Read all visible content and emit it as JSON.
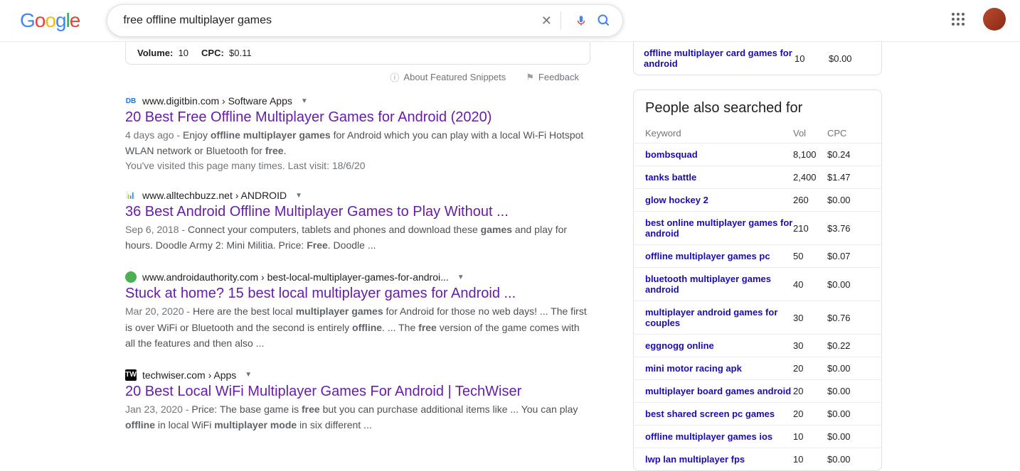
{
  "search": {
    "query": "free offline multiplayer games"
  },
  "metrics": {
    "volume_label": "Volume:",
    "volume_value": "10",
    "cpc_label": "CPC:",
    "cpc_value": "$0.11"
  },
  "snippet_links": {
    "about": "About Featured Snippets",
    "feedback": "Feedback"
  },
  "results": [
    {
      "favicon_text": "DB",
      "favicon_bg": "#fff",
      "favicon_color": "#1a73e8",
      "breadcrumb": "www.digitbin.com › Software Apps",
      "title": "20 Best Free Offline Multiplayer Games for Android (2020)",
      "date": "4 days ago",
      "snippet_html": "Enjoy <b>offline multiplayer games</b> for Android which you can play with a local Wi-Fi Hotspot WLAN network or Bluetooth for <b>free</b>.",
      "visited": "You've visited this page many times. Last visit: 18/6/20"
    },
    {
      "favicon_text": "📊",
      "favicon_bg": "#fff",
      "favicon_color": "#000",
      "breadcrumb": "www.alltechbuzz.net › ANDROID",
      "title": "36 Best Android Offline Multiplayer Games to Play Without ...",
      "date": "Sep 6, 2018",
      "snippet_html": "Connect your computers, tablets and phones and download these <b>games</b> and play for hours. Doodle Army 2: Mini Militia. Price: <b>Free</b>. Doodle ...",
      "visited": ""
    },
    {
      "favicon_text": "",
      "favicon_bg": "#4caf50",
      "favicon_color": "#fff",
      "favicon_round": true,
      "breadcrumb": "www.androidauthority.com › best-local-multiplayer-games-for-androi...",
      "title": "Stuck at home? 15 best local multiplayer games for Android ...",
      "date": "Mar 20, 2020",
      "snippet_html": "Here are the best local <b>multiplayer games</b> for Android for those no web days! ... The first is over WiFi or Bluetooth and the second is entirely <b>offline</b>. ... The <b>free</b> version of the game comes with all the features and then also ...",
      "visited": ""
    },
    {
      "favicon_text": "TW",
      "favicon_bg": "#000",
      "favicon_color": "#fff",
      "breadcrumb": "techwiser.com › Apps",
      "title": "20 Best Local WiFi Multiplayer Games For Android | TechWiser",
      "date": "Jan 23, 2020",
      "snippet_html": "Price: The base game is <b>free</b> but you can purchase additional items like ... You can play <b>offline</b> in local WiFi <b>multiplayer mode</b> in six different ...",
      "visited": ""
    }
  ],
  "top_related": {
    "keyword": "offline multiplayer card games for android",
    "vol": "10",
    "cpc": "$0.00"
  },
  "panel": {
    "title": "People also searched for",
    "headers": {
      "kw": "Keyword",
      "vol": "Vol",
      "cpc": "CPC"
    },
    "rows": [
      {
        "kw": "bombsquad",
        "vol": "8,100",
        "cpc": "$0.24"
      },
      {
        "kw": "tanks battle",
        "vol": "2,400",
        "cpc": "$1.47"
      },
      {
        "kw": "glow hockey 2",
        "vol": "260",
        "cpc": "$0.00"
      },
      {
        "kw": "best online multiplayer games for android",
        "vol": "210",
        "cpc": "$3.76"
      },
      {
        "kw": "offline multiplayer games pc",
        "vol": "50",
        "cpc": "$0.07"
      },
      {
        "kw": "bluetooth multiplayer games android",
        "vol": "40",
        "cpc": "$0.00"
      },
      {
        "kw": "multiplayer android games for couples",
        "vol": "30",
        "cpc": "$0.76"
      },
      {
        "kw": "eggnogg online",
        "vol": "30",
        "cpc": "$0.22"
      },
      {
        "kw": "mini motor racing apk",
        "vol": "20",
        "cpc": "$0.00"
      },
      {
        "kw": "multiplayer board games android",
        "vol": "20",
        "cpc": "$0.00"
      },
      {
        "kw": "best shared screen pc games",
        "vol": "20",
        "cpc": "$0.00"
      },
      {
        "kw": "offline multiplayer games ios",
        "vol": "10",
        "cpc": "$0.00"
      },
      {
        "kw": "lwp lan multiplayer fps",
        "vol": "10",
        "cpc": "$0.00"
      }
    ]
  }
}
